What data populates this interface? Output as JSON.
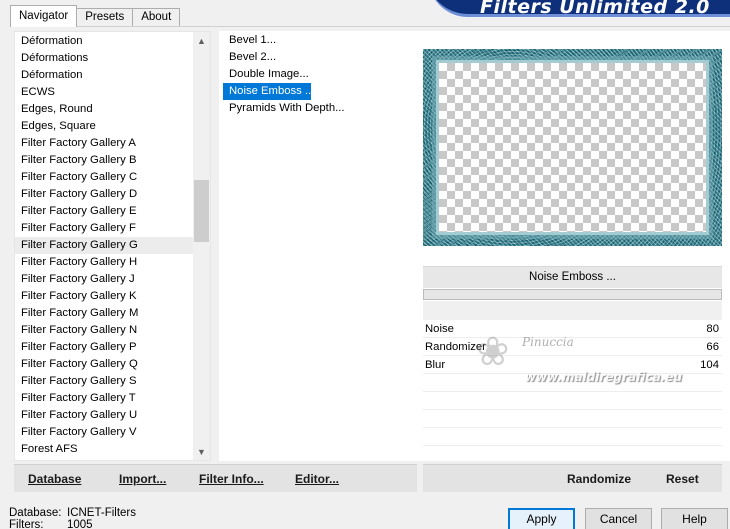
{
  "tabs": [
    {
      "label": "Navigator",
      "active": true
    },
    {
      "label": "Presets",
      "active": false
    },
    {
      "label": "About",
      "active": false
    }
  ],
  "banner_title": "Filters Unlimited 2.0",
  "categories": [
    "Déformation",
    "Déformations",
    "Déformation",
    "ECWS",
    "Edges, Round",
    "Edges, Square",
    "Filter Factory Gallery A",
    "Filter Factory Gallery B",
    "Filter Factory Gallery C",
    "Filter Factory Gallery D",
    "Filter Factory Gallery E",
    "Filter Factory Gallery F",
    "Filter Factory Gallery G",
    "Filter Factory Gallery H",
    "Filter Factory Gallery J",
    "Filter Factory Gallery K",
    "Filter Factory Gallery M",
    "Filter Factory Gallery N",
    "Filter Factory Gallery P",
    "Filter Factory Gallery Q",
    "Filter Factory Gallery S",
    "Filter Factory Gallery T",
    "Filter Factory Gallery U",
    "Filter Factory Gallery V",
    "Forest AFS"
  ],
  "hovered_category_index": 12,
  "filters": [
    "Bevel 1...",
    "Bevel 2...",
    "Double Image...",
    "Noise Emboss ...",
    "Pyramids With Depth..."
  ],
  "selected_filter_index": 3,
  "selected_filter_name": "Noise Emboss ...",
  "params": [
    {
      "name": "Noise",
      "value": "80"
    },
    {
      "name": "Randomizer",
      "value": "66"
    },
    {
      "name": "Blur",
      "value": "104"
    }
  ],
  "watermark": {
    "name": "Pinuccia",
    "url": "www.maldiregrafica.eu"
  },
  "toolbar": {
    "database": "Database",
    "import": "Import...",
    "filter_info": "Filter Info...",
    "editor": "Editor...",
    "randomize": "Randomize",
    "reset": "Reset"
  },
  "status": {
    "database_label": "Database:",
    "database_value": "ICNET-Filters",
    "filters_label": "Filters:",
    "filters_value": "1005"
  },
  "buttons": {
    "apply": "Apply",
    "cancel": "Cancel",
    "help": "Help"
  },
  "colors": {
    "banner": "#0e2f7a",
    "selection": "#0078d7",
    "frame": "#2a7b8a"
  }
}
